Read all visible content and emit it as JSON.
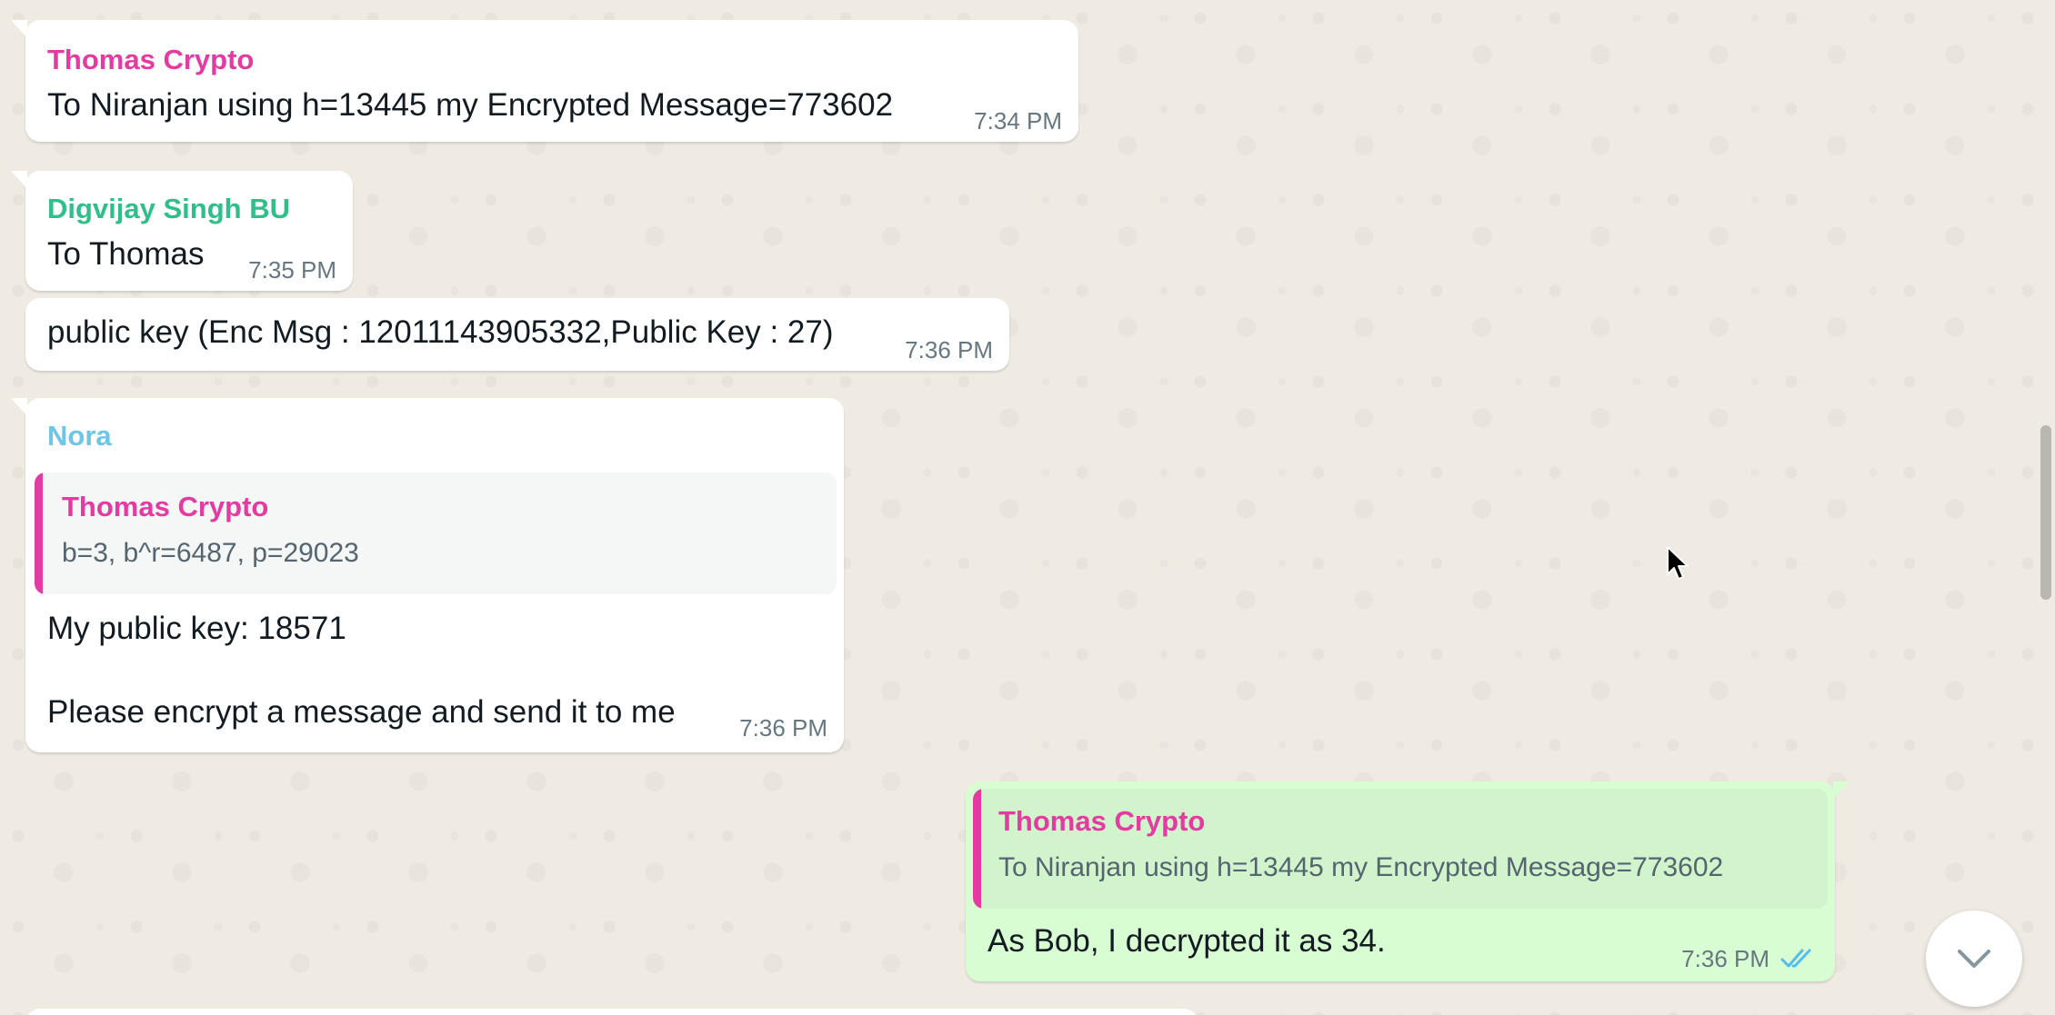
{
  "colors": {
    "background": "#efeae2",
    "incoming_bubble": "#ffffff",
    "outgoing_bubble": "#d9fdd3",
    "timestamp": "#667781",
    "read_ticks": "#53bdeb",
    "sender_thomas": "#e53aa1",
    "sender_digvijay": "#2fbf8a",
    "sender_nora": "#6ec6e6"
  },
  "messages": [
    {
      "sender": "Thomas Crypto",
      "text": "To Niranjan using h=13445 my Encrypted Message=773602",
      "time": "7:34 PM"
    },
    {
      "sender": "Digvijay Singh BU",
      "text": "To Thomas",
      "time": "7:35 PM"
    },
    {
      "text": "public key (Enc Msg : 12011143905332,Public Key : 27)",
      "time": "7:36 PM"
    },
    {
      "sender": "Nora",
      "quote": {
        "sender": "Thomas Crypto",
        "text": "b=3, b^r=6487, p=29023"
      },
      "line1": "My public key: 18571",
      "line2": "Please encrypt a message and send it to me",
      "time": "7:36 PM"
    },
    {
      "quote": {
        "sender": "Thomas Crypto",
        "text": "To Niranjan using h=13445 my Encrypted Message=773602"
      },
      "text": "As Bob, I decrypted it as 34.",
      "time": "7:36 PM",
      "status_icon": "double-check-read-icon"
    }
  ],
  "controls": {
    "scroll_down_icon": "chevron-down-icon"
  }
}
